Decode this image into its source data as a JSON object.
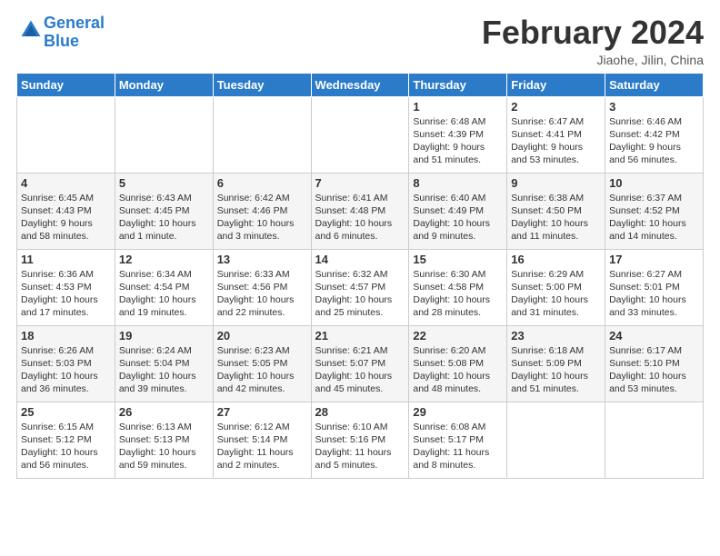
{
  "logo": {
    "text_general": "General",
    "text_blue": "Blue"
  },
  "title": "February 2024",
  "location": "Jiaohe, Jilin, China",
  "weekdays": [
    "Sunday",
    "Monday",
    "Tuesday",
    "Wednesday",
    "Thursday",
    "Friday",
    "Saturday"
  ],
  "weeks": [
    [
      {
        "day": "",
        "info": ""
      },
      {
        "day": "",
        "info": ""
      },
      {
        "day": "",
        "info": ""
      },
      {
        "day": "",
        "info": ""
      },
      {
        "day": "1",
        "info": "Sunrise: 6:48 AM\nSunset: 4:39 PM\nDaylight: 9 hours and 51 minutes."
      },
      {
        "day": "2",
        "info": "Sunrise: 6:47 AM\nSunset: 4:41 PM\nDaylight: 9 hours and 53 minutes."
      },
      {
        "day": "3",
        "info": "Sunrise: 6:46 AM\nSunset: 4:42 PM\nDaylight: 9 hours and 56 minutes."
      }
    ],
    [
      {
        "day": "4",
        "info": "Sunrise: 6:45 AM\nSunset: 4:43 PM\nDaylight: 9 hours and 58 minutes."
      },
      {
        "day": "5",
        "info": "Sunrise: 6:43 AM\nSunset: 4:45 PM\nDaylight: 10 hours and 1 minute."
      },
      {
        "day": "6",
        "info": "Sunrise: 6:42 AM\nSunset: 4:46 PM\nDaylight: 10 hours and 3 minutes."
      },
      {
        "day": "7",
        "info": "Sunrise: 6:41 AM\nSunset: 4:48 PM\nDaylight: 10 hours and 6 minutes."
      },
      {
        "day": "8",
        "info": "Sunrise: 6:40 AM\nSunset: 4:49 PM\nDaylight: 10 hours and 9 minutes."
      },
      {
        "day": "9",
        "info": "Sunrise: 6:38 AM\nSunset: 4:50 PM\nDaylight: 10 hours and 11 minutes."
      },
      {
        "day": "10",
        "info": "Sunrise: 6:37 AM\nSunset: 4:52 PM\nDaylight: 10 hours and 14 minutes."
      }
    ],
    [
      {
        "day": "11",
        "info": "Sunrise: 6:36 AM\nSunset: 4:53 PM\nDaylight: 10 hours and 17 minutes."
      },
      {
        "day": "12",
        "info": "Sunrise: 6:34 AM\nSunset: 4:54 PM\nDaylight: 10 hours and 19 minutes."
      },
      {
        "day": "13",
        "info": "Sunrise: 6:33 AM\nSunset: 4:56 PM\nDaylight: 10 hours and 22 minutes."
      },
      {
        "day": "14",
        "info": "Sunrise: 6:32 AM\nSunset: 4:57 PM\nDaylight: 10 hours and 25 minutes."
      },
      {
        "day": "15",
        "info": "Sunrise: 6:30 AM\nSunset: 4:58 PM\nDaylight: 10 hours and 28 minutes."
      },
      {
        "day": "16",
        "info": "Sunrise: 6:29 AM\nSunset: 5:00 PM\nDaylight: 10 hours and 31 minutes."
      },
      {
        "day": "17",
        "info": "Sunrise: 6:27 AM\nSunset: 5:01 PM\nDaylight: 10 hours and 33 minutes."
      }
    ],
    [
      {
        "day": "18",
        "info": "Sunrise: 6:26 AM\nSunset: 5:03 PM\nDaylight: 10 hours and 36 minutes."
      },
      {
        "day": "19",
        "info": "Sunrise: 6:24 AM\nSunset: 5:04 PM\nDaylight: 10 hours and 39 minutes."
      },
      {
        "day": "20",
        "info": "Sunrise: 6:23 AM\nSunset: 5:05 PM\nDaylight: 10 hours and 42 minutes."
      },
      {
        "day": "21",
        "info": "Sunrise: 6:21 AM\nSunset: 5:07 PM\nDaylight: 10 hours and 45 minutes."
      },
      {
        "day": "22",
        "info": "Sunrise: 6:20 AM\nSunset: 5:08 PM\nDaylight: 10 hours and 48 minutes."
      },
      {
        "day": "23",
        "info": "Sunrise: 6:18 AM\nSunset: 5:09 PM\nDaylight: 10 hours and 51 minutes."
      },
      {
        "day": "24",
        "info": "Sunrise: 6:17 AM\nSunset: 5:10 PM\nDaylight: 10 hours and 53 minutes."
      }
    ],
    [
      {
        "day": "25",
        "info": "Sunrise: 6:15 AM\nSunset: 5:12 PM\nDaylight: 10 hours and 56 minutes."
      },
      {
        "day": "26",
        "info": "Sunrise: 6:13 AM\nSunset: 5:13 PM\nDaylight: 10 hours and 59 minutes."
      },
      {
        "day": "27",
        "info": "Sunrise: 6:12 AM\nSunset: 5:14 PM\nDaylight: 11 hours and 2 minutes."
      },
      {
        "day": "28",
        "info": "Sunrise: 6:10 AM\nSunset: 5:16 PM\nDaylight: 11 hours and 5 minutes."
      },
      {
        "day": "29",
        "info": "Sunrise: 6:08 AM\nSunset: 5:17 PM\nDaylight: 11 hours and 8 minutes."
      },
      {
        "day": "",
        "info": ""
      },
      {
        "day": "",
        "info": ""
      }
    ]
  ]
}
